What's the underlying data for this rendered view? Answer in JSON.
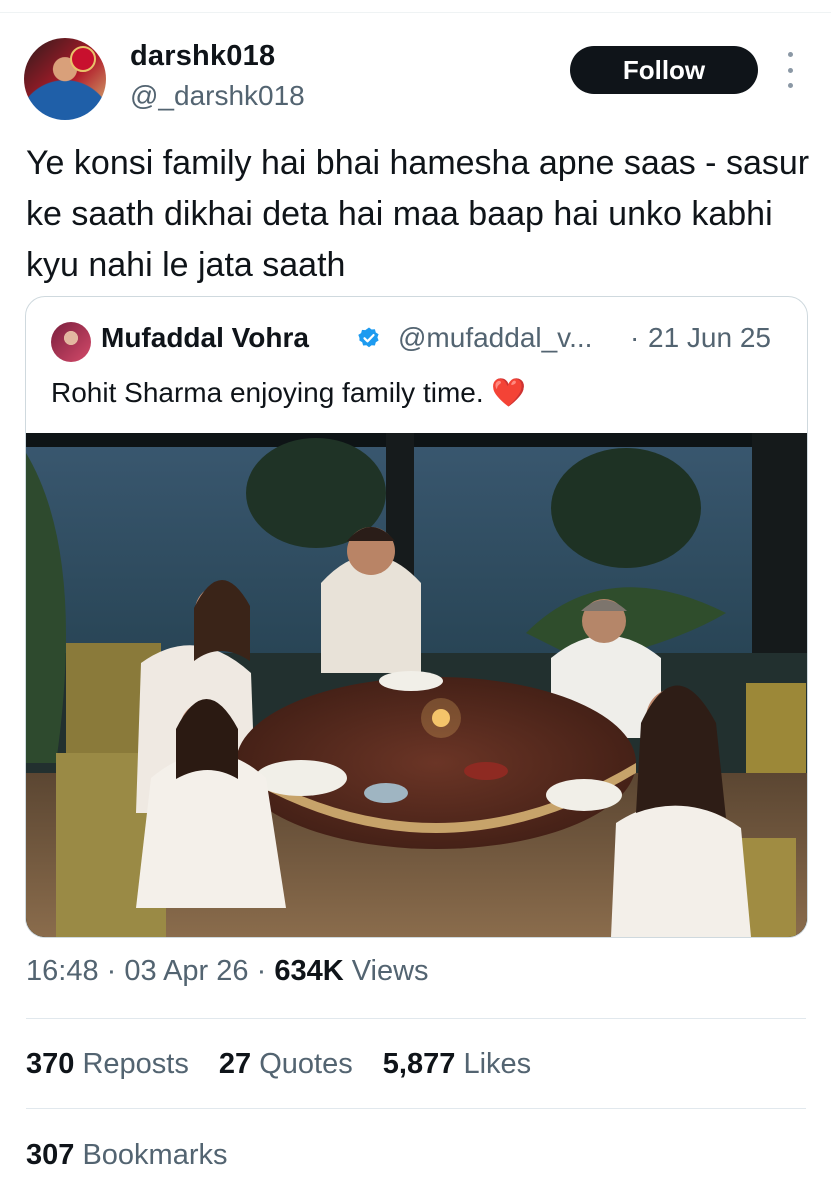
{
  "post": {
    "author_name": "darshk018",
    "author_handle": "@_darshk018",
    "follow_label": "Follow",
    "text": "Ye konsi family hai bhai hamesha apne saas - sasur ke saath dikhai deta hai maa baap hai unko kabhi kyu nahi le jata saath",
    "time": "16:48",
    "date": "03 Apr 26",
    "sep": "·",
    "views_count": "634K",
    "views_label": "Views"
  },
  "quoted": {
    "author_name": "Mufaddal Vohra",
    "author_handle": "@mufaddal_v...",
    "sep": "·",
    "date": "21 Jun 25",
    "text": "Rohit Sharma enjoying family time.",
    "emoji": "❤️",
    "verified_color": "#1d9bf0"
  },
  "stats": {
    "reposts_count": "370",
    "reposts_label": "Reposts",
    "quotes_count": "27",
    "quotes_label": "Quotes",
    "likes_count": "5,877",
    "likes_label": "Likes",
    "bookmarks_count": "307",
    "bookmarks_label": "Bookmarks"
  },
  "icons": {
    "more": "more-vertical-icon",
    "verified": "verified-badge-icon"
  }
}
